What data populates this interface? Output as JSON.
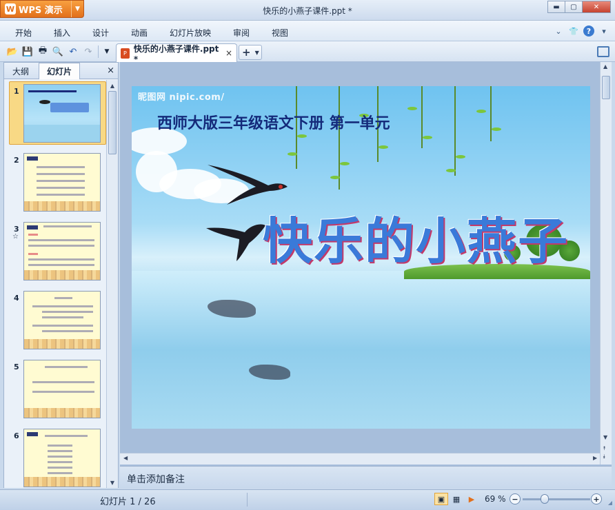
{
  "app": {
    "name": "WPS 演示",
    "logo_letter": "W"
  },
  "window": {
    "title": "快乐的小燕子课件.ppt *"
  },
  "menu": [
    "开始",
    "插入",
    "设计",
    "动画",
    "幻灯片放映",
    "审阅",
    "视图"
  ],
  "document_tab": {
    "label": "快乐的小燕子课件.ppt *",
    "close": "×"
  },
  "left_panel": {
    "tabs": [
      "大纲",
      "幻灯片"
    ],
    "active_tab": "幻灯片",
    "close": "×",
    "slides": [
      {
        "number": "1",
        "selected": true
      },
      {
        "number": "2"
      },
      {
        "number": "3",
        "has_animation": true,
        "animation_glyph": "☆"
      },
      {
        "number": "4"
      },
      {
        "number": "5"
      },
      {
        "number": "6"
      }
    ]
  },
  "slide": {
    "watermark": "昵图网 nipic.com/",
    "subtitle": "西师大版三年级语文下册  第一单元",
    "title": "快乐的小燕子"
  },
  "notes": {
    "placeholder": "单击添加备注"
  },
  "status": {
    "slide_counter": "幻灯片 1 / 26",
    "zoom": "69 %",
    "zoom_level_percent": 69
  },
  "colors": {
    "accent": "#e2701c",
    "title_blue": "#3a7ad9",
    "subtitle": "#142a7a"
  }
}
